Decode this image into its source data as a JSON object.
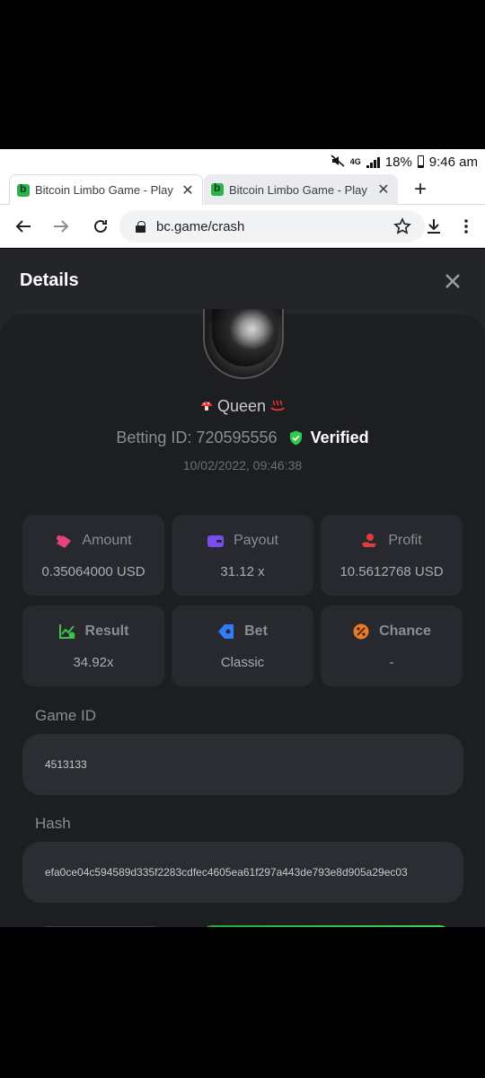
{
  "status_bar": {
    "signal_type": "4G",
    "battery": "18%",
    "time": "9:46 am"
  },
  "tabs": [
    {
      "title": "Bitcoin Limbo Game - Play Lin",
      "active": true
    },
    {
      "title": "Bitcoin Limbo Game - Play Lin",
      "active": false
    }
  ],
  "new_tab_label": "+",
  "url": "bc.game/crash",
  "dialog": {
    "title": "Details"
  },
  "user": {
    "name": "Queen",
    "betting_id_label": "Betting ID: 720595556",
    "verified": "Verified",
    "timestamp": "10/02/2022, 09:46:38"
  },
  "stats": {
    "amount": {
      "label": "Amount",
      "value": "0.35064000 USD"
    },
    "payout": {
      "label": "Payout",
      "value": "31.12 x"
    },
    "profit": {
      "label": "Profit",
      "value": "10.5612768 USD"
    },
    "result": {
      "label": "Result",
      "value": "34.92x"
    },
    "bet": {
      "label": "Bet",
      "value": "Classic"
    },
    "chance": {
      "label": "Chance",
      "value": "-"
    }
  },
  "game_id": {
    "label": "Game ID",
    "value": "4513133"
  },
  "hash": {
    "label": "Hash",
    "value": "efa0ce04c594589d335f2283cdfec4605ea61f297a443de793e8d905a29ec03"
  },
  "colors": {
    "page_bg": "#232529",
    "card_bg": "#1c1e22",
    "verified_green": "#2fcb4b",
    "amount_icon": "#e8437a",
    "payout_icon": "#7b4cf0",
    "profit_icon": "#e23b3b",
    "result_icon": "#3fc24a",
    "bet_icon": "#2f7cf6",
    "chance_icon": "#f07a1f"
  }
}
